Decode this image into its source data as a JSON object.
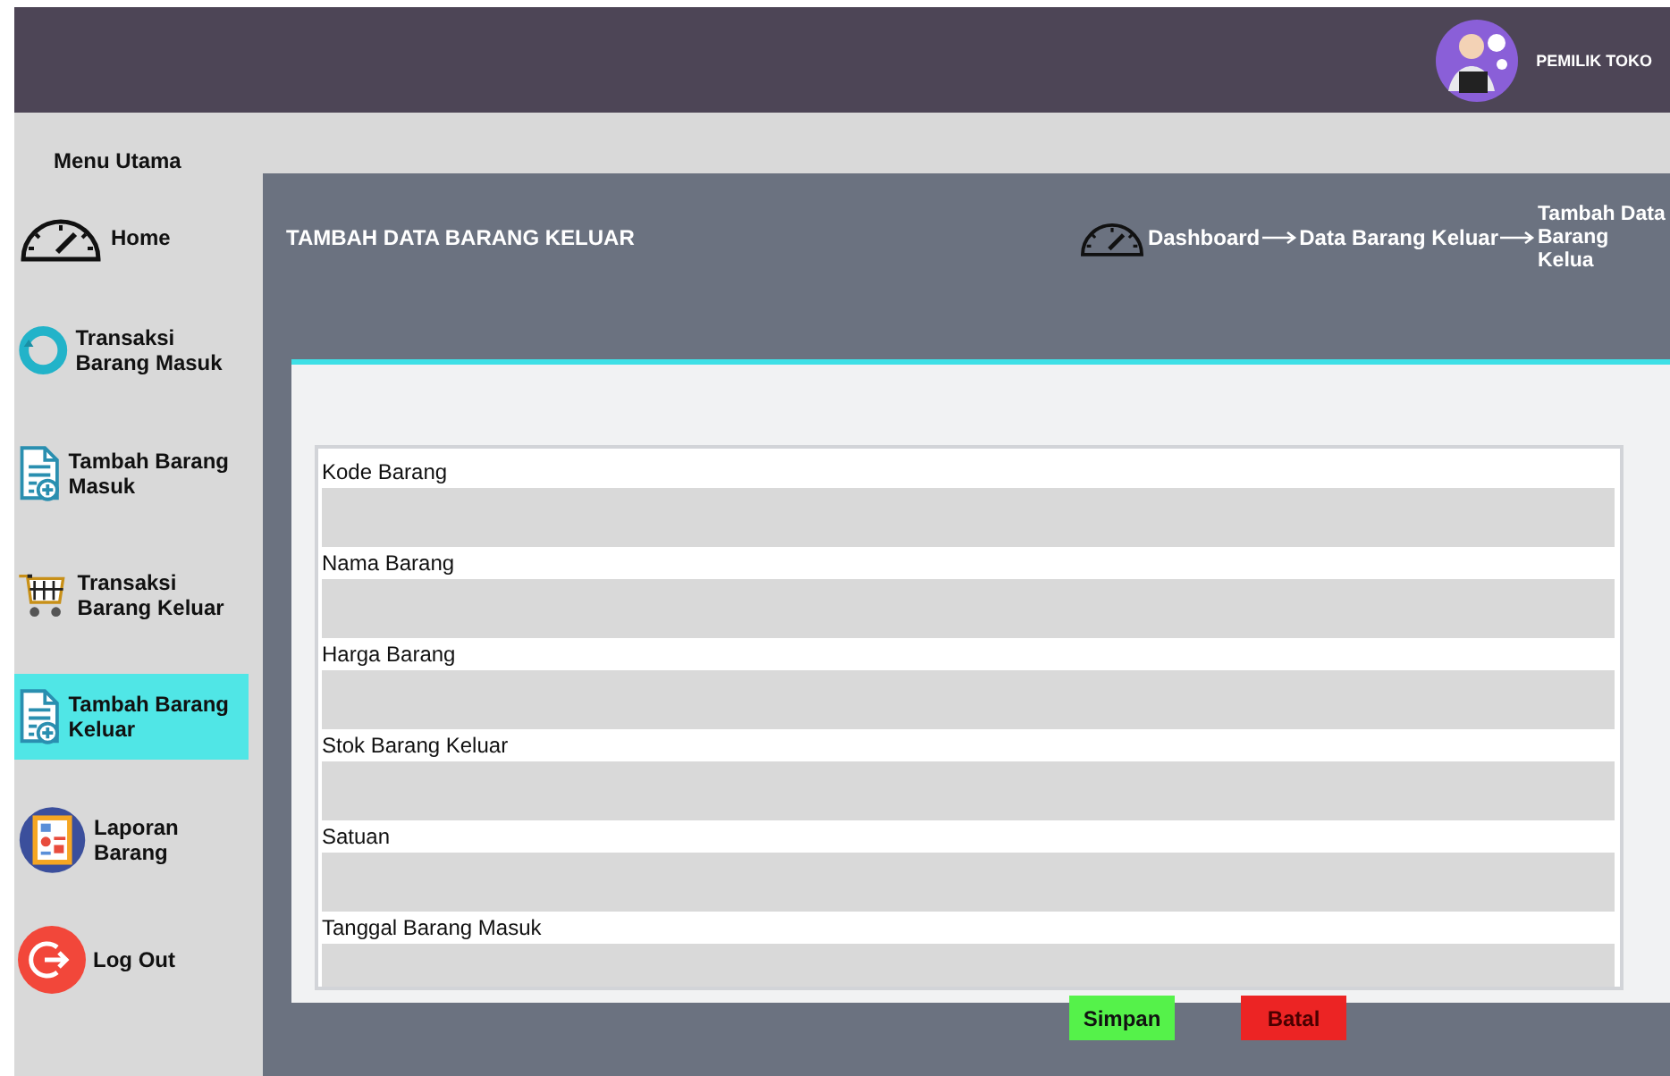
{
  "header": {
    "user": "PEMILIK TOKO"
  },
  "sidebar": {
    "title": "Menu Utama",
    "items": [
      {
        "label": "Home",
        "selected": false
      },
      {
        "label": "Transaksi Barang Masuk",
        "selected": false
      },
      {
        "label": "Tambah Barang Masuk",
        "selected": false
      },
      {
        "label": "Transaksi Barang Keluar",
        "selected": false
      },
      {
        "label": "Tambah Barang Keluar",
        "selected": true
      },
      {
        "label": "Laporan Barang",
        "selected": false
      },
      {
        "label": "Log Out",
        "selected": false
      }
    ]
  },
  "page": {
    "title": "TAMBAH DATA BARANG KELUAR",
    "breadcrumb": [
      "Dashboard",
      "Data Barang Keluar",
      "Tambah Data Barang Kelua"
    ]
  },
  "form": {
    "fields": [
      {
        "label": "Kode Barang"
      },
      {
        "label": "Nama Barang"
      },
      {
        "label": "Harga Barang"
      },
      {
        "label": "Stok Barang Keluar"
      },
      {
        "label": "Satuan"
      },
      {
        "label": "Tanggal Barang Masuk"
      }
    ],
    "buttons": [
      {
        "label": "Simpan",
        "kind": "save"
      },
      {
        "label": "Batal",
        "kind": "cancel"
      }
    ]
  }
}
